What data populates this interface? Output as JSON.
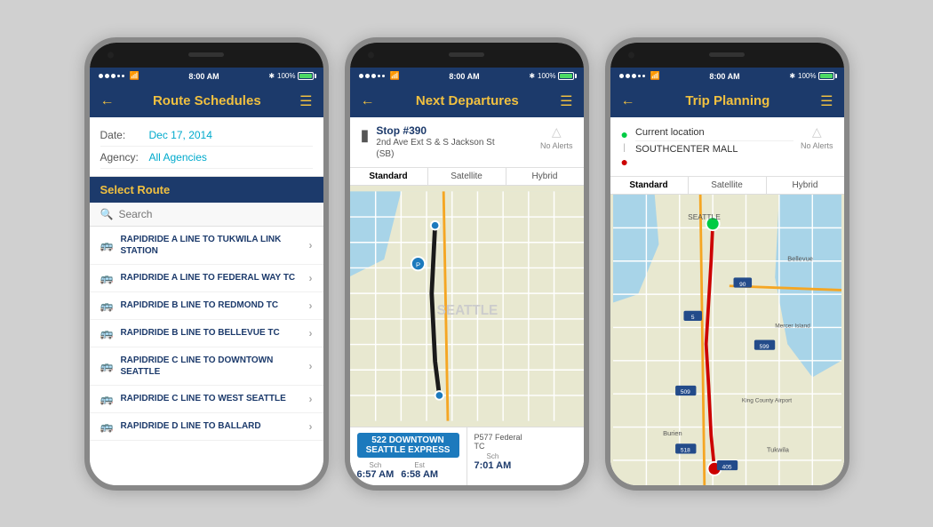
{
  "phones": [
    {
      "id": "phone1",
      "statusBar": {
        "time": "8:00 AM",
        "battery": "100%",
        "signal": "●●●○○"
      },
      "navBar": {
        "title": "Route Schedules",
        "hasBack": true,
        "hasMenu": true
      },
      "form": {
        "dateLabel": "Date:",
        "dateValue": "Dec 17, 2014",
        "agencyLabel": "Agency:",
        "agencyValue": "All Agencies"
      },
      "selectRoute": "Select Route",
      "searchPlaceholder": "Search",
      "routes": [
        {
          "id": 1,
          "text": "RAPIDRIDE A LINE TO TUKWILA LINK STATION"
        },
        {
          "id": 2,
          "text": "RAPIDRIDE A LINE TO FEDERAL WAY TC"
        },
        {
          "id": 3,
          "text": "RAPIDRIDE B LINE TO REDMOND TC"
        },
        {
          "id": 4,
          "text": "RAPIDRIDE B LINE TO BELLEVUE TC"
        },
        {
          "id": 5,
          "text": "RAPIDRIDE C LINE TO DOWNTOWN SEATTLE"
        },
        {
          "id": 6,
          "text": "RAPIDRIDE C LINE TO WEST SEATTLE"
        },
        {
          "id": 7,
          "text": "RAPIDRIDE D LINE TO BALLARD"
        }
      ]
    },
    {
      "id": "phone2",
      "statusBar": {
        "time": "8:00 AM",
        "battery": "100%"
      },
      "navBar": {
        "title": "Next Departures",
        "hasBack": true,
        "hasMenu": true
      },
      "stop": {
        "number": "Stop #390",
        "address": "2nd Ave Ext S & S Jackson St\n(SB)"
      },
      "noAlerts": "No Alerts",
      "mapTabs": [
        "Standard",
        "Satellite",
        "Hybrid"
      ],
      "activeTab": "Standard",
      "departures": [
        {
          "route": "522  DOWNTOWN\nSEATTLE EXPRESS",
          "scheduled": "6:57 AM",
          "estimated": "6:58 AM",
          "schedLabel": "Sch",
          "estLabel": "Est"
        },
        {
          "dest": "P577 Federal\nTC",
          "scheduled": "7:01 AM",
          "schedLabel": "Sch"
        }
      ]
    },
    {
      "id": "phone3",
      "statusBar": {
        "time": "8:00 AM",
        "battery": "100%"
      },
      "navBar": {
        "title": "Trip Planning",
        "hasBack": true,
        "hasMenu": true
      },
      "locations": {
        "from": "Current location",
        "to": "SOUTHCENTER MALL"
      },
      "noAlerts": "No Alerts",
      "mapTabs": [
        "Standard",
        "Satellite",
        "Hybrid"
      ],
      "activeTab": "Standard"
    }
  ]
}
